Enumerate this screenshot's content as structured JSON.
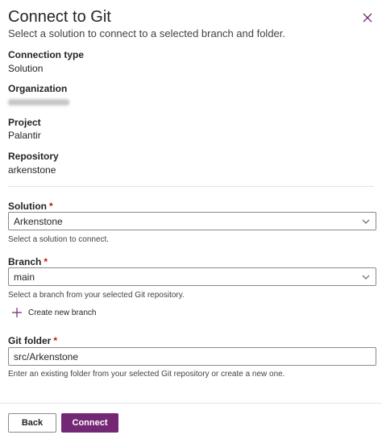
{
  "panel": {
    "title": "Connect to Git",
    "subtitle": "Select a solution to connect to a selected branch and folder.",
    "close_icon": "close-icon"
  },
  "info": {
    "connection_type_label": "Connection type",
    "connection_type_value": "Solution",
    "organization_label": "Organization",
    "project_label": "Project",
    "project_value": "Palantir",
    "repository_label": "Repository",
    "repository_value": "arkenstone"
  },
  "form": {
    "required_marker": "*",
    "solution_label": "Solution",
    "solution_value": "Arkenstone",
    "solution_hint": "Select a solution to connect.",
    "branch_label": "Branch",
    "branch_value": "main",
    "branch_hint": "Select a branch from your selected Git repository.",
    "create_branch_label": "Create new branch",
    "git_folder_label": "Git folder",
    "git_folder_value": "src/Arkenstone",
    "git_folder_hint": "Enter an existing folder from your selected Git repository or create a new one."
  },
  "footer": {
    "back_label": "Back",
    "connect_label": "Connect"
  },
  "colors": {
    "accent": "#742774",
    "required": "#c50f1f"
  }
}
